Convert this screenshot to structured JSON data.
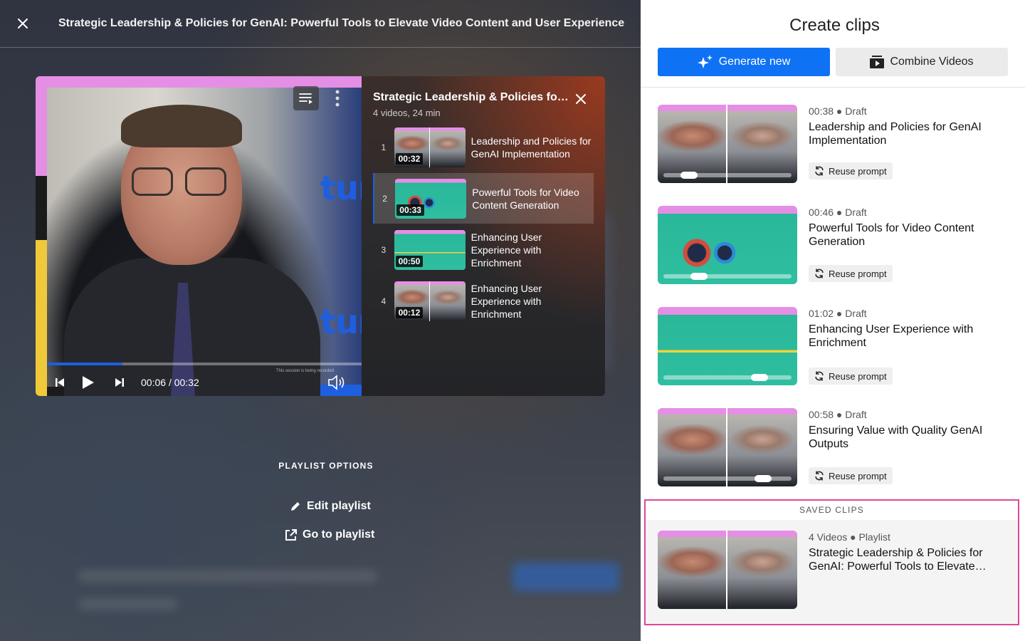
{
  "window": {
    "title": "Strategic Leadership & Policies for GenAI: Powerful Tools to Elevate Video Content and User Experience"
  },
  "player": {
    "current_time": "00:06",
    "duration": "00:32",
    "time_separator": "/",
    "progress_fraction": 0.24,
    "recording_note": "This session is being recorded",
    "brand_text": "tur"
  },
  "playlist": {
    "title": "Strategic Leadership & Policies for GenAI: Powerful Tools to Elevate Video Content and User Experience",
    "meta": "4 videos, 24 min",
    "items": [
      {
        "num": "1",
        "duration": "00:32",
        "label": "Leadership and Policies for GenAI Implementation",
        "thumb": "person"
      },
      {
        "num": "2",
        "duration": "00:33",
        "label": "Powerful Tools for Video Content Generation",
        "thumb": "slide"
      },
      {
        "num": "3",
        "duration": "00:50",
        "label": "Enhancing User Experience with Enrichment",
        "thumb": "timeline"
      },
      {
        "num": "4",
        "duration": "00:12",
        "label": "Enhancing User Experience with Enrichment",
        "thumb": "person"
      }
    ],
    "active_index": 1
  },
  "options": {
    "heading": "PLAYLIST OPTIONS",
    "edit_label": "Edit playlist",
    "goto_label": "Go to playlist"
  },
  "panel": {
    "title": "Create clips",
    "generate_label": "Generate new",
    "combine_label": "Combine Videos",
    "reuse_label": "Reuse prompt",
    "clips": [
      {
        "duration": "00:38",
        "status": "Draft",
        "title": "Leadership and Policies for GenAI Implementation",
        "thumb": "person",
        "scrub": 0.2
      },
      {
        "duration": "00:46",
        "status": "Draft",
        "title": "Powerful Tools for Video Content Generation",
        "thumb": "slide",
        "scrub": 0.28
      },
      {
        "duration": "01:02",
        "status": "Draft",
        "title": "Enhancing User Experience with Enrichment",
        "thumb": "timeline",
        "scrub": 0.75
      },
      {
        "duration": "00:58",
        "status": "Draft",
        "title": "Ensuring Value with Quality GenAI Outputs",
        "thumb": "person",
        "scrub": 0.78
      }
    ],
    "saved": {
      "heading": "SAVED CLIPS",
      "meta_count": "4 Videos",
      "meta_type": "Playlist",
      "title": "Strategic Leadership & Policies for GenAI: Powerful Tools to Elevate Video Content and User Experience"
    }
  },
  "colors": {
    "accent": "#0f72f5",
    "highlight_border": "#e0459a",
    "brand_pink": "#e58ee6",
    "brand_blue": "#1e5fe0",
    "brand_yellow": "#f0c93a"
  }
}
